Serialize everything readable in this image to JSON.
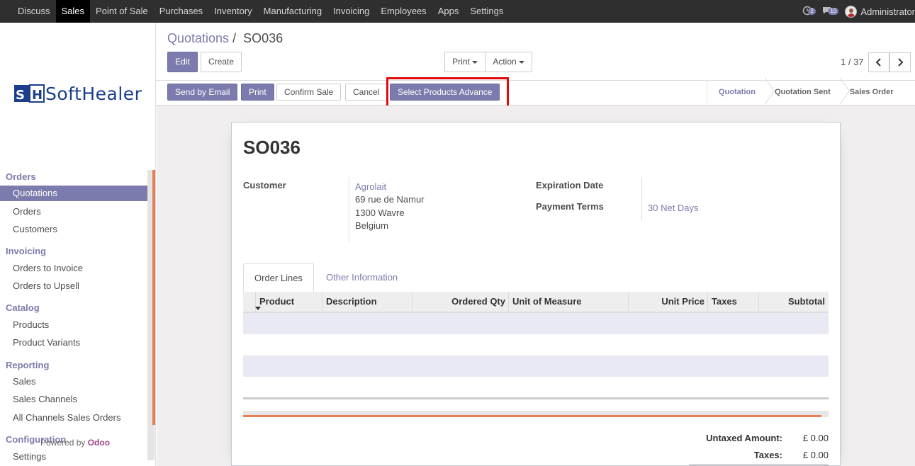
{
  "topbar": {
    "menu": [
      "Discuss",
      "Sales",
      "Point of Sale",
      "Purchases",
      "Inventory",
      "Manufacturing",
      "Invoicing",
      "Employees",
      "Apps",
      "Settings"
    ],
    "active": "Sales",
    "activity_count": "2",
    "messages_count": "10",
    "user": "Administrator"
  },
  "brand": {
    "logo_text": "SoftHealer"
  },
  "sidebar": {
    "sections": [
      {
        "title": "Orders",
        "items": [
          "Quotations",
          "Orders",
          "Customers"
        ]
      },
      {
        "title": "Invoicing",
        "items": [
          "Orders to Invoice",
          "Orders to Upsell"
        ]
      },
      {
        "title": "Catalog",
        "items": [
          "Products",
          "Product Variants"
        ]
      },
      {
        "title": "Reporting",
        "items": [
          "Sales",
          "Sales Channels",
          "All Channels Sales Orders"
        ]
      },
      {
        "title": "Configuration",
        "items": [
          "Settings"
        ]
      }
    ],
    "active_item": "Quotations",
    "powered_by": "Powered by",
    "powered_brand": "Odoo"
  },
  "control_panel": {
    "breadcrumb_parent": "Quotations",
    "breadcrumb_sep": "/",
    "breadcrumb_current": "SO036",
    "edit": "Edit",
    "create": "Create",
    "print": "Print",
    "action": "Action",
    "pager": "1 / 37"
  },
  "header": {
    "buttons": [
      "Send by Email",
      "Print",
      "Confirm Sale",
      "Cancel",
      "Select Products Advance"
    ],
    "stages": [
      "Quotation",
      "Quotation Sent",
      "Sales Order"
    ],
    "current_stage": "Quotation"
  },
  "form": {
    "title": "SO036",
    "customer_label": "Customer",
    "customer_name": "Agrolait",
    "address_line1": "69 rue de Namur",
    "address_line2": "1300 Wavre",
    "address_line3": "Belgium",
    "expiration_label": "Expiration Date",
    "expiration_value": "",
    "payment_terms_label": "Payment Terms",
    "payment_terms_value": "30 Net Days",
    "tabs": [
      "Order Lines",
      "Other Information"
    ],
    "columns": [
      "Product",
      "Description",
      "Ordered Qty",
      "Unit of Measure",
      "Unit Price",
      "Taxes",
      "Subtotal"
    ],
    "untaxed_label": "Untaxed Amount:",
    "untaxed_value": "£ 0.00",
    "taxes_label": "Taxes:",
    "taxes_value": "£ 0.00"
  },
  "colors": {
    "accent": "#7c7bad",
    "nav_bg": "#2f2f2f",
    "highlight": "#e20b0b",
    "scroll": "#e57e55"
  }
}
